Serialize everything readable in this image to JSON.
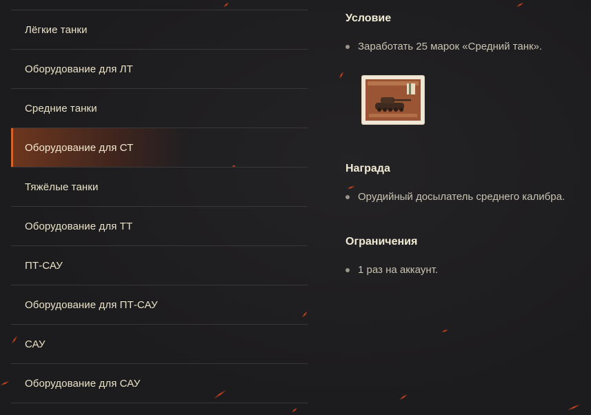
{
  "menu": {
    "items": [
      {
        "label": "Лёгкие танки",
        "active": false
      },
      {
        "label": "Оборудование для ЛТ",
        "active": false
      },
      {
        "label": "Средние танки",
        "active": false
      },
      {
        "label": "Оборудование для СТ",
        "active": true
      },
      {
        "label": "Тяжёлые танки",
        "active": false
      },
      {
        "label": "Оборудование для ТТ",
        "active": false
      },
      {
        "label": "ПТ-САУ",
        "active": false
      },
      {
        "label": "Оборудование для ПТ-САУ",
        "active": false
      },
      {
        "label": "САУ",
        "active": false
      },
      {
        "label": "Оборудование для САУ",
        "active": false
      }
    ]
  },
  "condition": {
    "title": "Условие",
    "items": [
      "Заработать 25 марок «Средний танк»."
    ],
    "stamp_icon": "tank-stamp-icon"
  },
  "reward": {
    "title": "Награда",
    "items": [
      "Орудийный досылатель среднего калибра."
    ]
  },
  "limits": {
    "title": "Ограничения",
    "items": [
      "1 раз на аккаунт."
    ]
  },
  "colors": {
    "accent": "#d8632a",
    "text": "#ebe3c9",
    "background": "#1c1b1d"
  }
}
